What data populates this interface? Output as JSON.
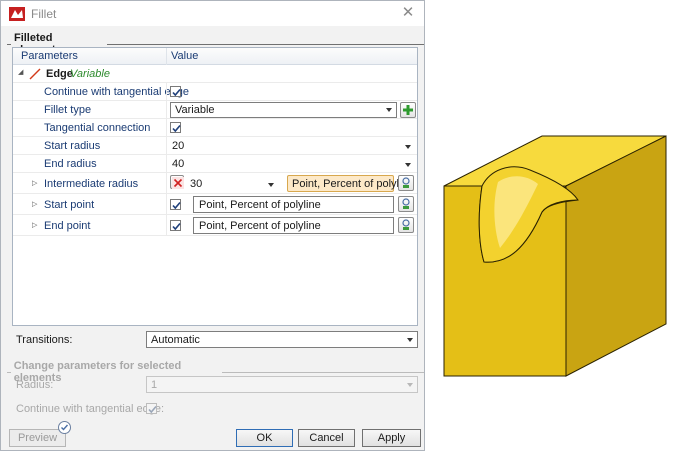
{
  "window": {
    "title": "Fillet",
    "close_glyph": "✕",
    "icon": "fillet-app-icon"
  },
  "filleted_elements": {
    "group_title": "Filleted elements",
    "columns": {
      "parameters": "Parameters",
      "value": "Value"
    },
    "edge": {
      "label": "Edge",
      "variant": "Variable",
      "variant_color": "#2c8a2c"
    },
    "rows": {
      "continue_tangential": {
        "label": "Continue with tangential edge",
        "checked": true
      },
      "fillet_type": {
        "label": "Fillet type",
        "value": "Variable"
      },
      "tangential_connection": {
        "label": "Tangential connection",
        "checked": true
      },
      "start_radius": {
        "label": "Start radius",
        "value": "20"
      },
      "end_radius": {
        "label": "End radius",
        "value": "40"
      },
      "intermediate_radius": {
        "label": "Intermediate radius",
        "value": "30",
        "button": "Point, Percent of polyli..."
      },
      "start_point": {
        "label": "Start point",
        "checked": true,
        "value": "Point, Percent of polyline"
      },
      "end_point": {
        "label": "End point",
        "checked": true,
        "value": "Point, Percent of polyline"
      }
    }
  },
  "transitions": {
    "label": "Transitions:",
    "value": "Automatic"
  },
  "change_params": {
    "group_title": "Change parameters for selected elements",
    "radius": {
      "label": "Radius:",
      "value": "1"
    },
    "continue_tangential": {
      "label": "Continue with tangential edge:",
      "checked": true
    }
  },
  "buttons": {
    "preview": "Preview",
    "ok": "OK",
    "cancel": "Cancel",
    "apply": "Apply"
  },
  "colors": {
    "cube_top": "#f5d63a",
    "cube_front": "#e2bd16",
    "cube_right": "#c9a414",
    "edge_accent": "#d33a1a"
  }
}
